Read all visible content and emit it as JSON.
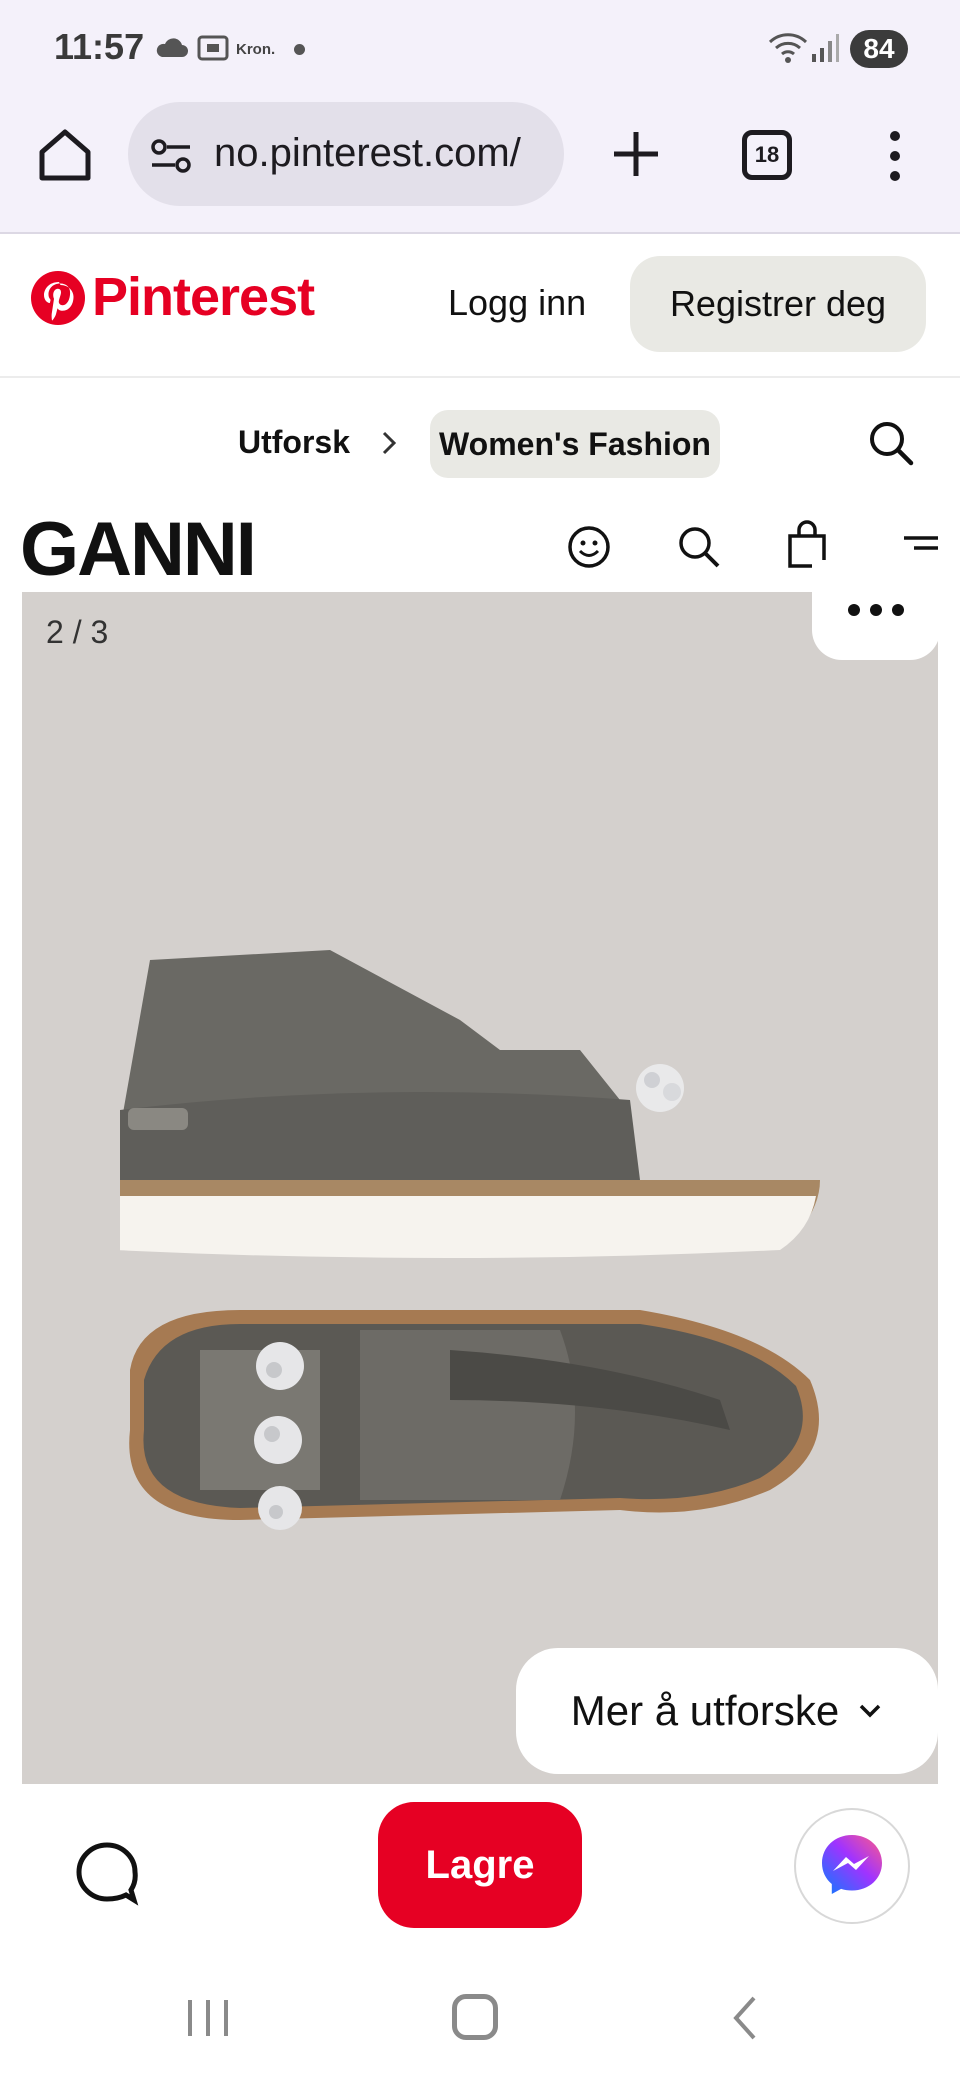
{
  "status_bar": {
    "time": "11:57",
    "notification_label": "Kron.",
    "battery": "84",
    "icons": [
      "cloud-icon",
      "screenshot-icon",
      "wifi-icon",
      "signal-icon"
    ]
  },
  "browser": {
    "url": "no.pinterest.com/",
    "tab_count": "18",
    "icons": [
      "home-icon",
      "site-settings-icon",
      "new-tab-icon",
      "more-options-icon"
    ]
  },
  "header": {
    "brand": "Pinterest",
    "brand_color": "#e60023",
    "login_label": "Logg inn",
    "signup_label": "Registrer deg"
  },
  "breadcrumb": {
    "root": "Utforsk",
    "current": "Women's Fashion"
  },
  "pin": {
    "store_logo": "GANNI",
    "image_counter": "2 / 3",
    "product": "sandals with crystal embellishments",
    "explore_label": "Mer å utforske"
  },
  "actions": {
    "save_label": "Lagre",
    "accent": "#e60023"
  }
}
